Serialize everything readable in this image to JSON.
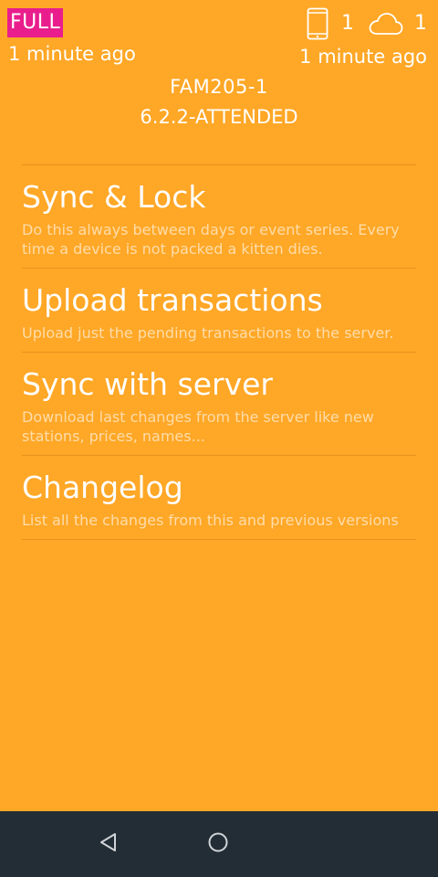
{
  "header": {
    "mode_badge": "FULL",
    "local_updated": "1 minute ago",
    "device_icon": "phone-icon",
    "device_count": "1",
    "cloud_icon": "cloud-icon",
    "cloud_count": "1",
    "server_updated": "1 minute ago",
    "device_id": "FAM205-1",
    "version": "6.2.2-ATTENDED",
    "badge_color": "#E91E8C",
    "background_color": "#FFA726"
  },
  "menu": {
    "items": [
      {
        "title": "Sync & Lock",
        "description": "Do this always between days or event series. Every time a device is not packed a kitten dies."
      },
      {
        "title": "Upload transactions",
        "description": "Upload just the pending transactions to the server."
      },
      {
        "title": "Sync with server",
        "description": "Download last changes from the server like new stations, prices, names..."
      },
      {
        "title": "Changelog",
        "description": "List all the changes from this and previous versions"
      }
    ]
  },
  "navbar": {
    "back_icon": "back-triangle-icon",
    "home_icon": "home-circle-icon",
    "color": "#232D35"
  }
}
